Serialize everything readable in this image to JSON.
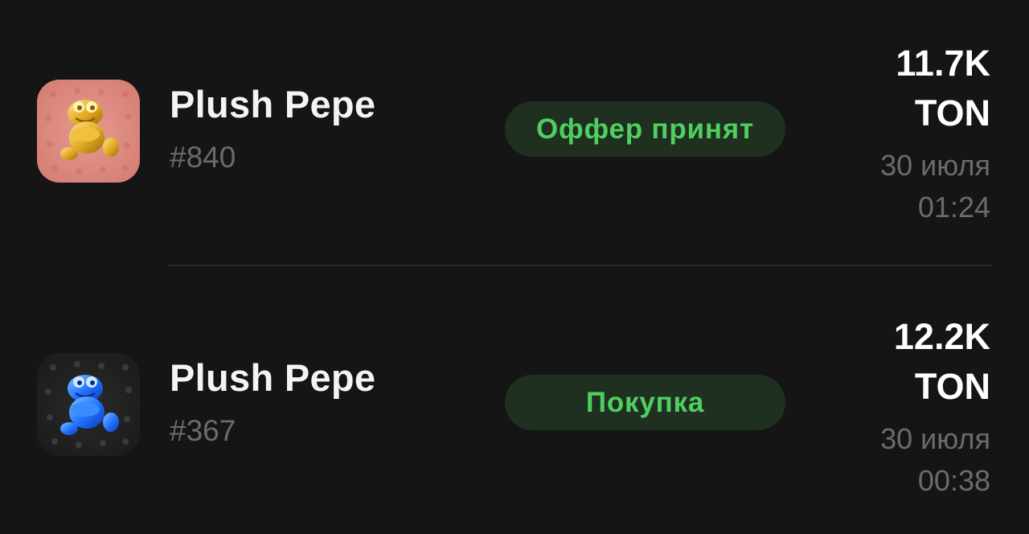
{
  "items": [
    {
      "name": "Plush Pepe",
      "number": "#840",
      "status": "Оффер принят",
      "price_amount": "11.7K",
      "price_currency": "TON",
      "date": "30 июля",
      "time": "01:24",
      "thumbnail_icon": "gold-plush-pepe-icon"
    },
    {
      "name": "Plush Pepe",
      "number": "#367",
      "status": "Покупка",
      "price_amount": "12.2K",
      "price_currency": "TON",
      "date": "30 июля",
      "time": "00:38",
      "thumbnail_icon": "blue-plush-pepe-icon"
    }
  ],
  "colors": {
    "background": "#151515",
    "status_bg": "#1f2f20",
    "status_text": "#4fcf60",
    "secondary_text": "#6b6b6b"
  }
}
